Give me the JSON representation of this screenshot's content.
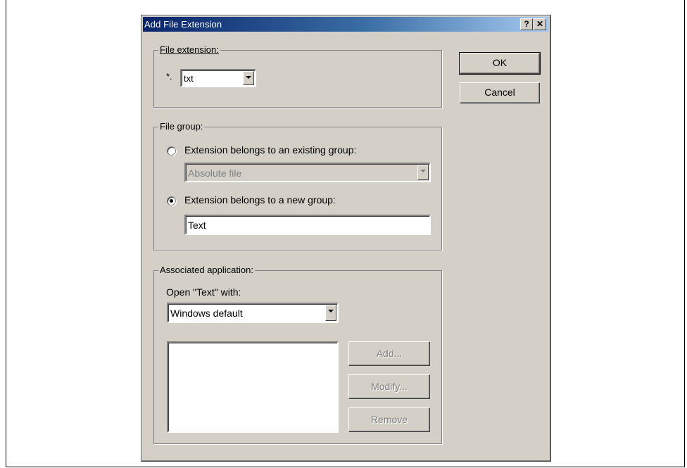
{
  "dialog": {
    "title": "Add File Extension",
    "help_label": "?",
    "close_label": "✕"
  },
  "buttons": {
    "ok": "OK",
    "cancel": "Cancel"
  },
  "file_extension": {
    "group_label": "File extension:",
    "prefix": "*.",
    "value": "txt"
  },
  "file_group": {
    "group_label": "File group:",
    "existing_label": "Extension belongs to an existing group:",
    "existing_value": "Absolute file",
    "new_label": "Extension belongs to a new group:",
    "new_value": "Text",
    "selected": "new"
  },
  "associated_app": {
    "group_label": "Associated application:",
    "open_with_label": "Open \"Text\" with:",
    "open_with_value": "Windows default",
    "add_label": "Add...",
    "modify_label": "Modify...",
    "remove_label": "Remove"
  },
  "colors": {
    "title_start": "#0a246a",
    "title_end": "#a6caf0",
    "face": "#d4d0c8"
  }
}
